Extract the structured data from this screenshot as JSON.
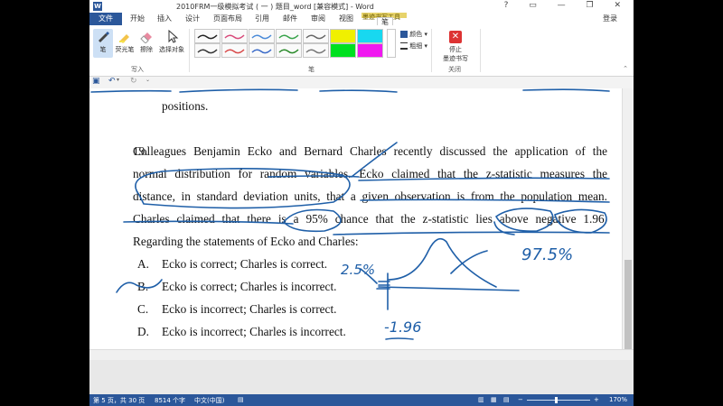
{
  "window": {
    "title": "2010FRM一级模拟考试 ( 一 ) 题目_word [兼容模式] - Word",
    "logo": "W",
    "controls": "? ▭ — ❐ ✕"
  },
  "tabs": [
    {
      "label": "文件"
    },
    {
      "label": "开始"
    },
    {
      "label": "插入"
    },
    {
      "label": "设计"
    },
    {
      "label": "页面布局"
    },
    {
      "label": "引用"
    },
    {
      "label": "邮件"
    },
    {
      "label": "审阅"
    },
    {
      "label": "视图"
    },
    {
      "label": "墨迹书写工具"
    },
    {
      "label": "笔"
    }
  ],
  "user": "登录",
  "ribbon": {
    "tools": [
      {
        "label": "笔",
        "icon": "pen-icon"
      },
      {
        "label": "荧光笔",
        "icon": "highlighter-icon"
      },
      {
        "label": "擦除",
        "icon": "eraser-icon"
      },
      {
        "label": "选择对象",
        "icon": "select-object-icon"
      }
    ],
    "write_group": "写入",
    "pens_group": "笔",
    "color_label": "颜色",
    "thickness_label": "粗细",
    "stop_label_1": "停止",
    "stop_label_2": "墨迹书写",
    "close_group": "关闭",
    "pen_colors": [
      "#222222",
      "#d84a7a",
      "#4a8ad8",
      "#37a34a",
      "#666666",
      "#f0f000",
      "#18d8f0",
      "#333333",
      "#d84a4a",
      "#3a6ac8",
      "#2a8a2a",
      "#777777",
      "#00e020",
      "#f018f0"
    ]
  },
  "document": {
    "fragment": "positions.",
    "question_number": "19.",
    "lines": [
      "Colleagues Benjamin Ecko and Bernard Charles recently discussed the application of the",
      "normal distribution for random variables. Ecko claimed that the z-statistic measures the",
      "distance, in standard deviation units, that a given observation is from the population mean.",
      "Charles claimed that there is a 95% chance that the z-statistic lies above negative 1.96."
    ],
    "prompt": "Regarding the statements of Ecko and Charles:",
    "options": [
      {
        "letter": "A.",
        "text": "Ecko is correct; Charles is correct."
      },
      {
        "letter": "B.",
        "text": "Ecko is correct; Charles is incorrect."
      },
      {
        "letter": "C.",
        "text": "Ecko is incorrect; Charles is correct."
      },
      {
        "letter": "D.",
        "text": "Ecko is incorrect; Charles is incorrect."
      }
    ],
    "handwriting": {
      "pct_left": "2.5%",
      "pct_right": "97.5%",
      "z_value": "-1.96"
    }
  },
  "status": {
    "page": "第 5 页，共 30 页",
    "words": "8514 个字",
    "language": "中文(中国)",
    "zoom": "170%"
  }
}
